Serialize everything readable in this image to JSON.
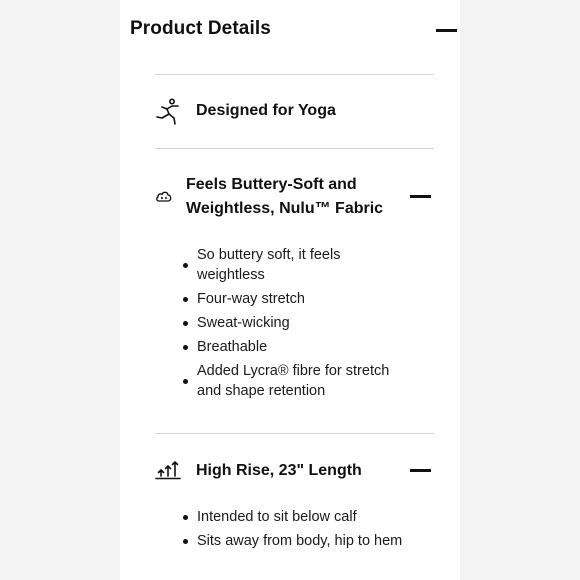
{
  "header": {
    "title": "Product Details",
    "toggle_icon": "minus-icon"
  },
  "sections": [
    {
      "icon": "yoga-pose-icon",
      "title": "Designed for Yoga",
      "expanded": false
    },
    {
      "icon": "cloud-icon",
      "title": "Feels Buttery-Soft and Weightless, Nulu™ Fabric",
      "expanded": true,
      "toggle_icon": "minus-icon",
      "bullets": [
        "So buttery soft, it feels weightless",
        "Four-way stretch",
        "Sweat-wicking",
        "Breathable",
        "Added Lycra® fibre for stretch and shape retention"
      ]
    },
    {
      "icon": "rise-arrows-icon",
      "title": "High Rise, 23\" Length",
      "expanded": true,
      "toggle_icon": "minus-icon",
      "bullets": [
        "Intended to sit below calf",
        "Sits away from body, hip to hem"
      ]
    }
  ]
}
